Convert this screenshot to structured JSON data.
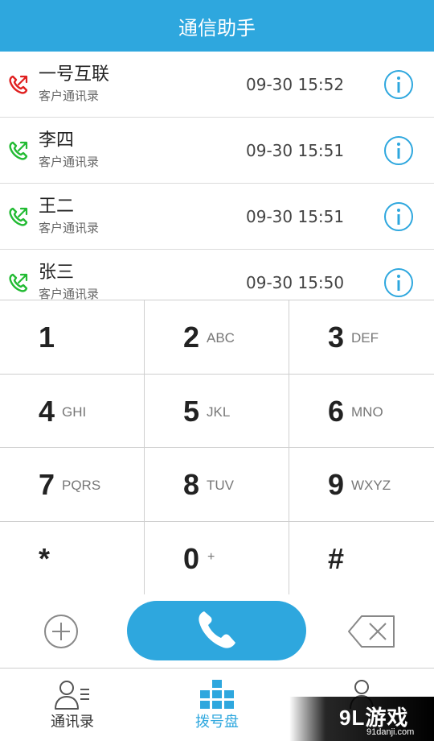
{
  "header": {
    "title": "通信助手"
  },
  "colors": {
    "accent": "#2ea7de",
    "outgoing_missed": "#e02020",
    "outgoing": "#22bb33"
  },
  "calls": [
    {
      "name": "一号互联",
      "source": "客户通讯录",
      "time": "09-30 15:52",
      "direction_icon": "outgoing-call-icon",
      "status_color": "#e02020"
    },
    {
      "name": "李四",
      "source": "客户通讯录",
      "time": "09-30 15:51",
      "direction_icon": "outgoing-call-icon",
      "status_color": "#22bb33"
    },
    {
      "name": "王二",
      "source": "客户通讯录",
      "time": "09-30 15:51",
      "direction_icon": "outgoing-call-icon",
      "status_color": "#22bb33"
    },
    {
      "name": "张三",
      "source": "客户通讯录",
      "time": "09-30 15:50",
      "direction_icon": "outgoing-call-icon",
      "status_color": "#22bb33"
    }
  ],
  "dialpad": {
    "keys": [
      {
        "digit": "1",
        "letters": ""
      },
      {
        "digit": "2",
        "letters": "ABC"
      },
      {
        "digit": "3",
        "letters": "DEF"
      },
      {
        "digit": "4",
        "letters": "GHI"
      },
      {
        "digit": "5",
        "letters": "JKL"
      },
      {
        "digit": "6",
        "letters": "MNO"
      },
      {
        "digit": "7",
        "letters": "PQRS"
      },
      {
        "digit": "8",
        "letters": "TUV"
      },
      {
        "digit": "9",
        "letters": "WXYZ"
      },
      {
        "digit": "*",
        "letters": ""
      },
      {
        "digit": "0",
        "letters": "+"
      },
      {
        "digit": "#",
        "letters": ""
      }
    ]
  },
  "actions": {
    "add_icon": "plus-circle-icon",
    "call_icon": "phone-handset-icon",
    "backspace_icon": "backspace-icon"
  },
  "tabs": [
    {
      "label": "通讯录",
      "icon": "contacts-icon",
      "active": false
    },
    {
      "label": "拨号盘",
      "icon": "dialpad-grid-icon",
      "active": true
    },
    {
      "label": "",
      "icon": "person-icon",
      "active": false
    }
  ],
  "watermark": {
    "logo": "9L游戏",
    "url": "91danji.com"
  }
}
